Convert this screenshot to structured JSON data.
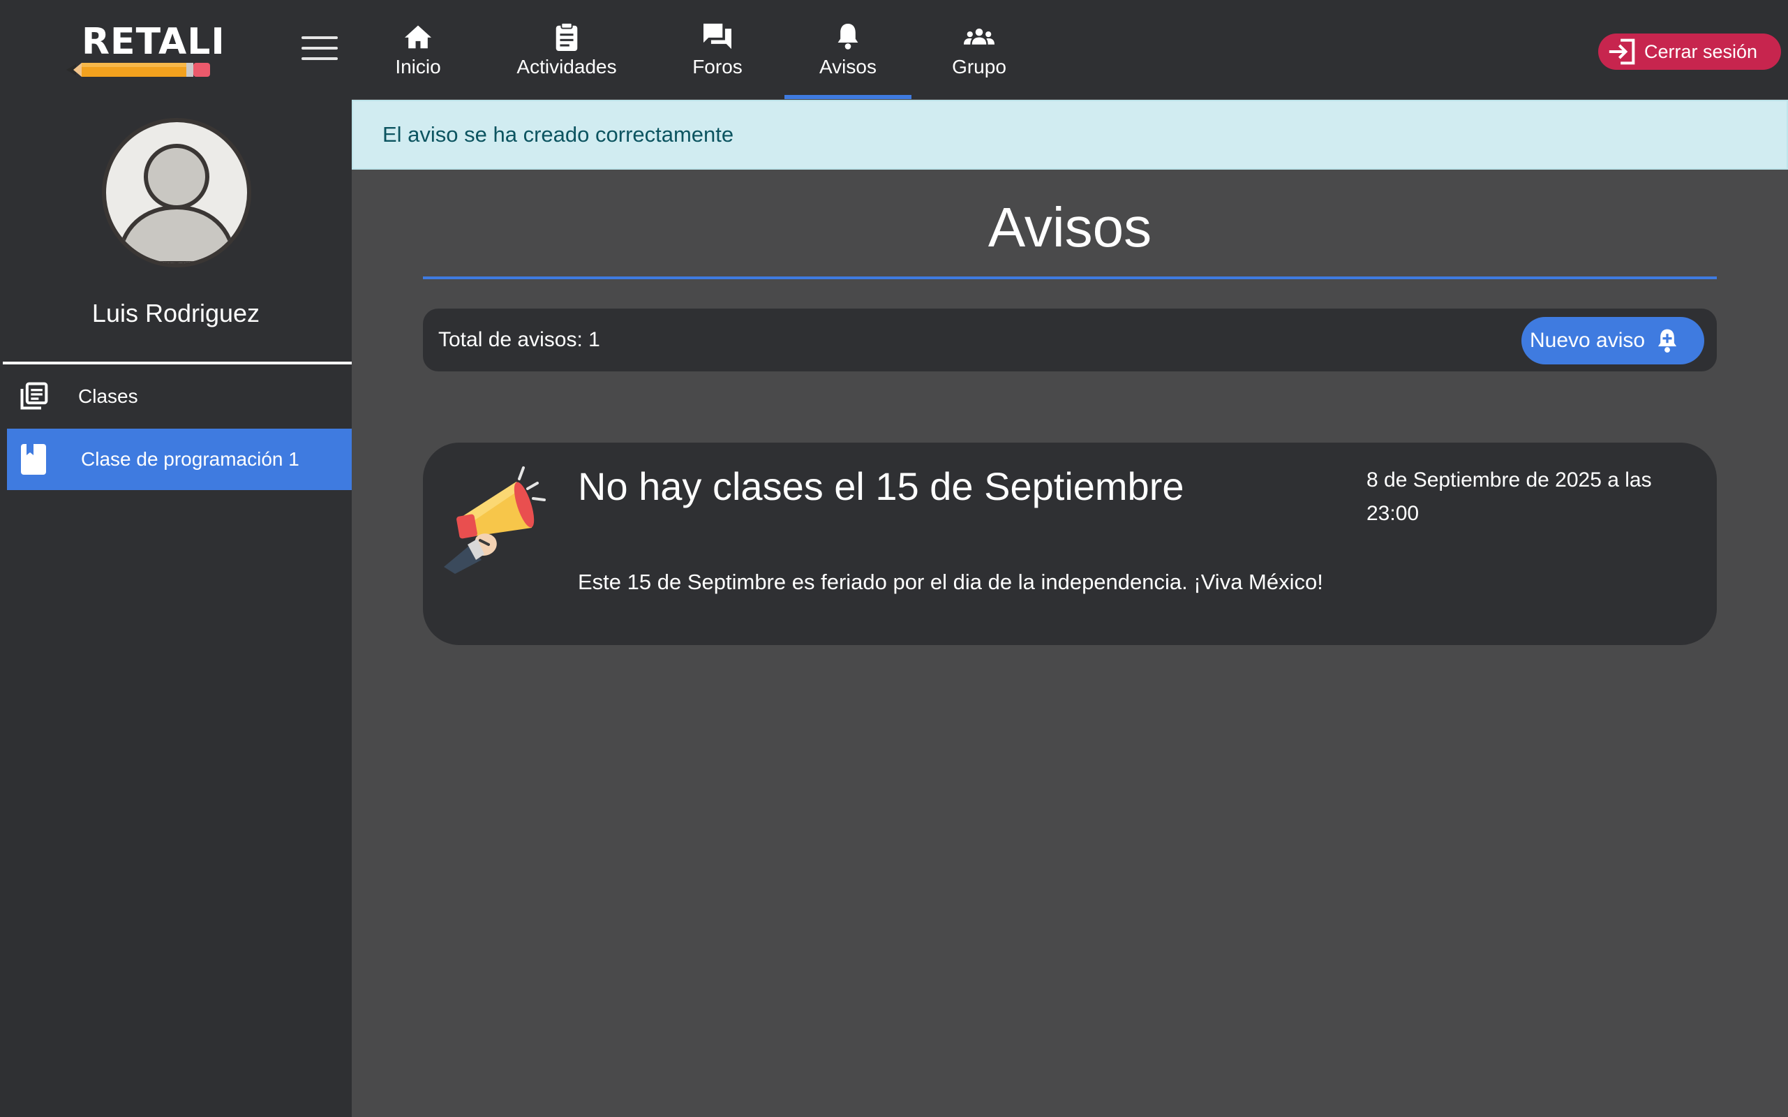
{
  "header": {
    "logo_text": "RETALI",
    "nav": [
      {
        "label": "Inicio",
        "icon": "home-icon"
      },
      {
        "label": "Actividades",
        "icon": "clipboard-icon"
      },
      {
        "label": "Foros",
        "icon": "forum-icon"
      },
      {
        "label": "Avisos",
        "icon": "bell-icon",
        "active": true
      },
      {
        "label": "Grupo",
        "icon": "group-icon"
      }
    ],
    "logout_label": "Cerrar sesión"
  },
  "sidebar": {
    "username": "Luis Rodriguez",
    "items": [
      {
        "label": "Clases",
        "icon": "library-books-icon"
      },
      {
        "label": "Clase de programación 1",
        "icon": "book-icon",
        "selected": true
      }
    ]
  },
  "main": {
    "alert_text": "El aviso se ha creado correctamente",
    "title": "Avisos",
    "total_label": "Total de avisos: 1",
    "new_button_label": "Nuevo aviso",
    "notices": [
      {
        "title": "No hay clases el 15 de Septiembre",
        "date": "8 de Septiembre de 2025 a las 23:00",
        "body": "Este 15 de Septimbre es feriado por el dia de la independencia. ¡Viva México!",
        "icon": "megaphone-icon"
      }
    ]
  },
  "colors": {
    "accent": "#3f7be0",
    "danger": "#c7254e",
    "panel": "#2f3033",
    "background": "#4a4a4b",
    "alert_bg": "#d1ecf1",
    "alert_text": "#0c5460"
  }
}
